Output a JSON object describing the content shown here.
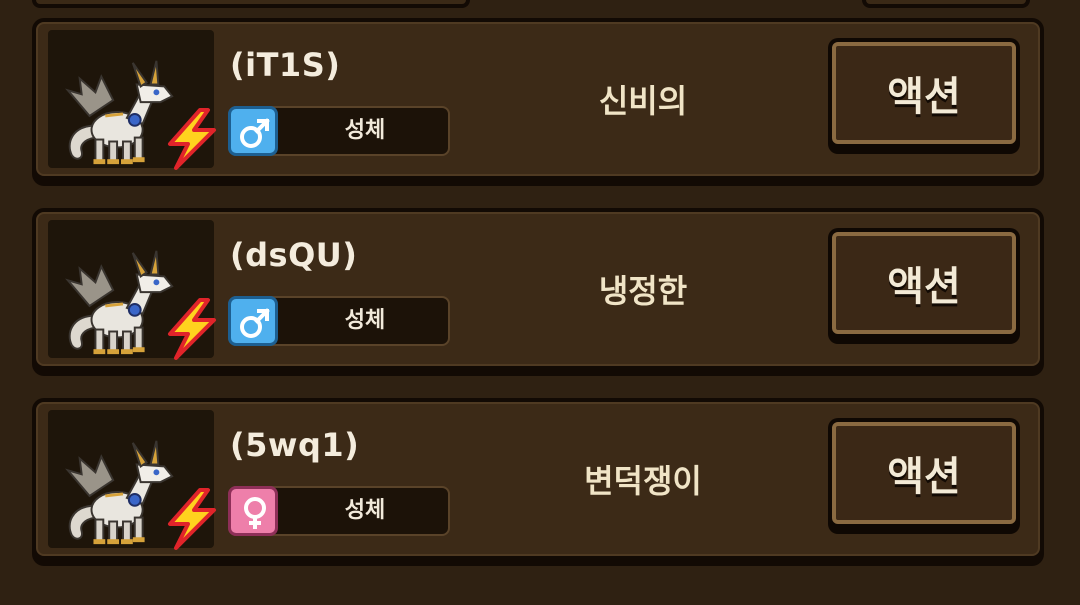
{
  "dragons": [
    {
      "name": "(iT1S)",
      "gender": "male",
      "gender_icon": "male-symbol-icon",
      "stage": "성체",
      "personality": "신비의",
      "action_label": "액션",
      "orb_color": "#3a66c8"
    },
    {
      "name": "(dsQU)",
      "gender": "male",
      "gender_icon": "male-symbol-icon",
      "stage": "성체",
      "personality": "냉정한",
      "action_label": "액션",
      "orb_color": "#3a66c8"
    },
    {
      "name": "(5wq1)",
      "gender": "female",
      "gender_icon": "female-symbol-icon",
      "stage": "성체",
      "personality": "변덕쟁이",
      "action_label": "액션",
      "orb_color": "#3a66c8"
    }
  ],
  "colors": {
    "background": "#2f2112",
    "panel": "#3c2a17",
    "male": "#4fb0ee",
    "female": "#ee7faa",
    "bolt": "#ffd21e"
  },
  "element_icon": "lightning-bolt-icon"
}
